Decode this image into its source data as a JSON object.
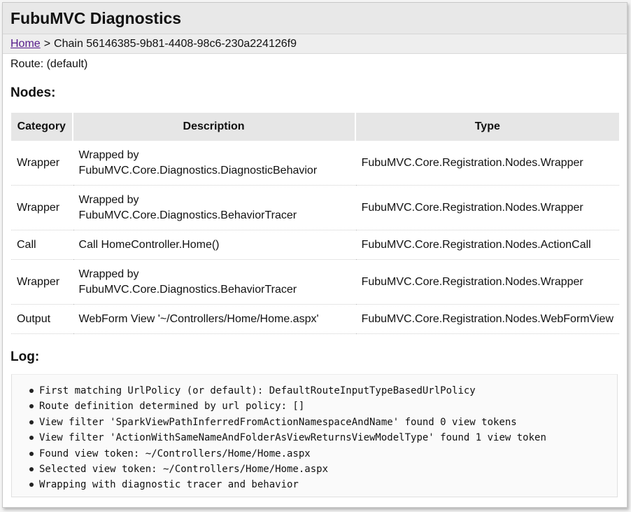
{
  "app": {
    "title": "FubuMVC Diagnostics"
  },
  "breadcrumb": {
    "home_link": "Home",
    "separator": ">",
    "current": "Chain 56146385-9b81-4408-98c6-230a224126f9"
  },
  "route": {
    "text": "Route: (default)"
  },
  "nodes": {
    "heading": "Nodes:",
    "columns": [
      "Category",
      "Description",
      "Type"
    ],
    "rows": [
      {
        "category": "Wrapper",
        "desc_line1": "Wrapped by",
        "desc_line2": "FubuMVC.Core.Diagnostics.DiagnosticBehavior",
        "type": "FubuMVC.Core.Registration.Nodes.Wrapper"
      },
      {
        "category": "Wrapper",
        "desc_line1": "Wrapped by",
        "desc_line2": "FubuMVC.Core.Diagnostics.BehaviorTracer",
        "type": "FubuMVC.Core.Registration.Nodes.Wrapper"
      },
      {
        "category": "Call",
        "desc_line1": "Call HomeController.Home()",
        "type": "FubuMVC.Core.Registration.Nodes.ActionCall"
      },
      {
        "category": "Wrapper",
        "desc_line1": "Wrapped by",
        "desc_line2": "FubuMVC.Core.Diagnostics.BehaviorTracer",
        "type": "FubuMVC.Core.Registration.Nodes.Wrapper"
      },
      {
        "category": "Output",
        "desc_line1": "WebForm View '~/Controllers/Home/Home.aspx'",
        "type": "FubuMVC.Core.Registration.Nodes.WebFormView"
      }
    ]
  },
  "log": {
    "heading": "Log:",
    "entries": [
      "First matching UrlPolicy (or default): DefaultRouteInputTypeBasedUrlPolicy",
      "Route definition determined by url policy: []",
      "View filter 'SparkViewPathInferredFromActionNamespaceAndName' found 0 view tokens",
      "View filter 'ActionWithSameNameAndFolderAsViewReturnsViewModelType' found 1 view token",
      "Found view token: ~/Controllers/Home/Home.aspx",
      "Selected view token: ~/Controllers/Home/Home.aspx",
      "Wrapping with diagnostic tracer and behavior"
    ]
  }
}
